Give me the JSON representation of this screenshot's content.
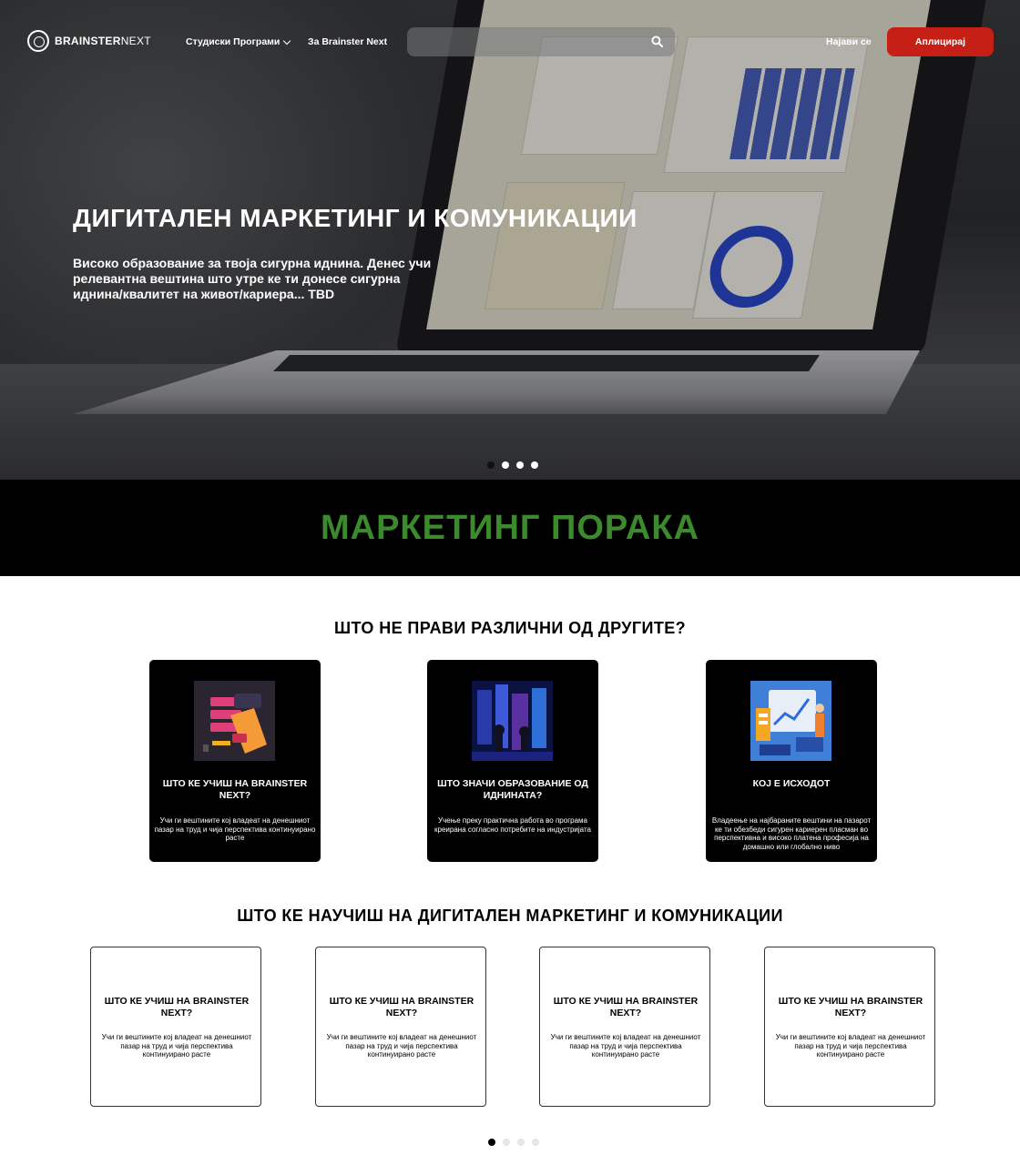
{
  "nav": {
    "logo_bold": "BRAINSTER",
    "logo_light": "NEXT",
    "programs_label": "Студиски Програми",
    "about_label": "За Brainster Next",
    "search_placeholder": "",
    "login_label": "Најави се",
    "apply_label": "Аплицирај"
  },
  "hero": {
    "title": "ДИГИТАЛЕН МАРКЕТИНГ И КОМУНИКАЦИИ",
    "subtitle": "Високо образование за твоја сигурна иднина. Денес учи релевантна вештина што утре ке ти донесе сигурна иднина/квалитет на живот/кариера... TBD",
    "slides_total": 4,
    "active_slide": 1
  },
  "banner": {
    "text": "МАРКЕТИНГ ПОРАКА"
  },
  "differences": {
    "title": "ШТО НЕ ПРАВИ РАЗЛИЧНИ ОД ДРУГИТЕ?",
    "cards": [
      {
        "title": "ШТО КЕ УЧИШ НА BRAINSTER NEXT?",
        "desc": "Учи ги вештините кој владеат на денешниот пазар на труд и чија перспектива континуирано расте",
        "image": "marketing-illustration"
      },
      {
        "title": "ШТО ЗНАЧИ ОБРАЗОВАНИЕ ОД ИДНИНАТА?",
        "desc": "Учење преку практична работа во програма креирана согласно потребите на индустријата",
        "image": "future-city-illustration"
      },
      {
        "title": "КОЈ Е ИСХОДОТ",
        "desc": "Владеење на најбараните вештини на пазарот ке ти обезбеди сигурен кариерен пласман во перспективна и високо платена професија на домашно или глобално ниво",
        "image": "analytics-illustration"
      }
    ]
  },
  "learn": {
    "title": "ШТО КЕ НАУЧИШ НА ДИГИТАЛЕН МАРКЕТИНГ И КОМУНИКАЦИИ",
    "cards": [
      {
        "title": "ШТО КЕ УЧИШ НА BRAINSTER NEXT?",
        "desc": "Учи ги вештините кој владеат на денешниот пазар на труд и чија перспектива континуирано расте"
      },
      {
        "title": "ШТО КЕ УЧИШ НА BRAINSTER NEXT?",
        "desc": "Учи ги вештините кој владеат на денешниот пазар на труд и чија перспектива континуирано расте"
      },
      {
        "title": "ШТО КЕ УЧИШ НА BRAINSTER NEXT?",
        "desc": "Учи ги вештините кој владеат на денешниот пазар на труд и чија перспектива континуирано расте"
      },
      {
        "title": "ШТО КЕ УЧИШ НА BRAINSTER NEXT?",
        "desc": "Учи ги вештините кој владеат на денешниот пазар на труд и чија перспектива континуирано расте"
      }
    ],
    "pages_total": 4,
    "active_page": 1
  },
  "colors": {
    "accent_red": "#c62016",
    "banner_green": "#3c8a2d",
    "card_dark": "#000000"
  }
}
